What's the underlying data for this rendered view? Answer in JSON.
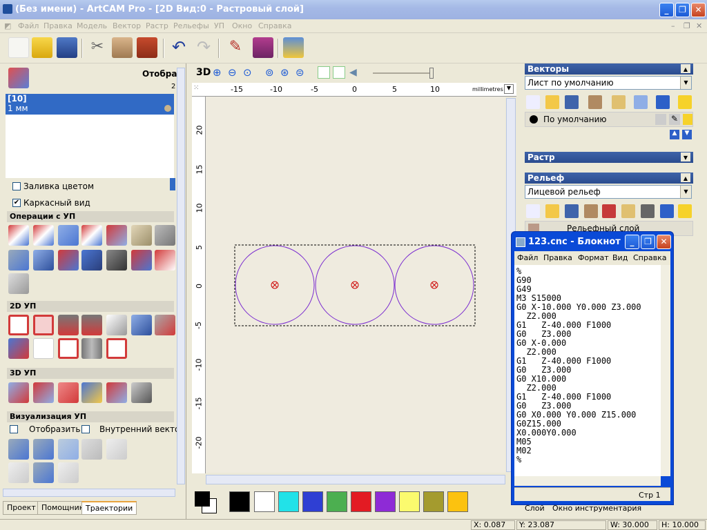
{
  "app": {
    "title": "(Без имени) - ArtCAM Pro - [2D Вид:0 - Растровый слой]"
  },
  "menu": [
    "Файл",
    "Правка",
    "Модель",
    "Вектор",
    "Растр",
    "Рельефы",
    "УП",
    "Окно",
    "Справка"
  ],
  "left": {
    "top_label": "Отобра",
    "top_digit": "2",
    "list_items": [
      "[10]",
      "1 мм"
    ],
    "checkbox_fill": "Заливка цветом",
    "checkbox_wire": "Каркасный вид",
    "sections": [
      "Операции с УП",
      "2D УП",
      "3D УП",
      "Визуализация УП"
    ],
    "viz_show": "Отобразить",
    "viz_inner": "Внутренний вектор",
    "tabs": [
      "Проект",
      "Помощник",
      "Траектории"
    ]
  },
  "view": {
    "mode_label": "3D",
    "units": "millimetres",
    "x_ticks": [
      "-15",
      "-10",
      "-5",
      "0",
      "5",
      "10"
    ],
    "y_ticks": [
      "20",
      "15",
      "10",
      "5",
      "0",
      "-5",
      "-10",
      "-15",
      "-20"
    ]
  },
  "palette": [
    "#000000",
    "#ffffff",
    "#22e2e8",
    "#2f3fd3",
    "#4caf50",
    "#e31b23",
    "#8e2bd6",
    "#fbfa6e",
    "#a49b2e",
    "#fcc20f"
  ],
  "right": {
    "vectors_title": "Векторы",
    "vectors_sheet": "Лист по умолчанию",
    "layer_default": "По умолчанию",
    "raster_title": "Растр",
    "relief_title": "Рельеф",
    "relief_select": "Лицевой рельеф",
    "relief_layer": "Рельефный слой",
    "bottom_tabs": [
      "Слой",
      "Окно инструментария"
    ]
  },
  "notepad": {
    "title": "123.cnc - Блокнот",
    "menu": [
      "Файл",
      "Правка",
      "Формат",
      "Вид",
      "Справка"
    ],
    "content": "%\nG90\nG49\nM3 S15000\nG0 X-10.000 Y0.000 Z3.000\n  Z2.000\nG1   Z-40.000 F1000\nG0   Z3.000\nG0 X-0.000\n  Z2.000\nG1   Z-40.000 F1000\nG0   Z3.000\nG0 X10.000\n  Z2.000\nG1   Z-40.000 F1000\nG0   Z3.000\nG0 X0.000 Y0.000 Z15.000\nG0Z15.000\nX0.000Y0.000\nM05\nM02\n%",
    "status": "Стр 1"
  },
  "status": {
    "x": "X: 0.087",
    "y": "Y: 23.087",
    "w": "W: 30.000",
    "h": "H: 10.000"
  }
}
